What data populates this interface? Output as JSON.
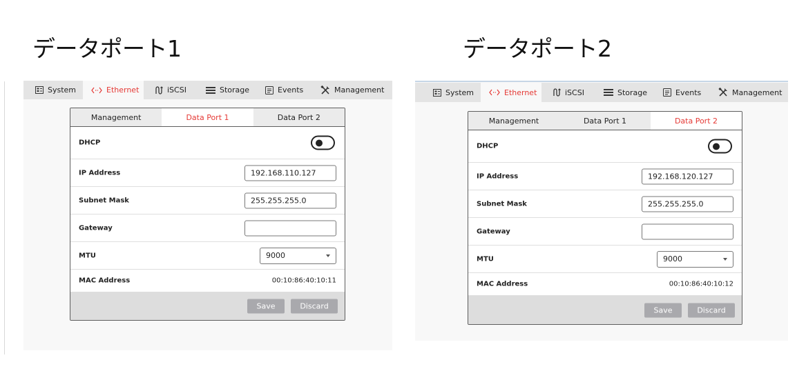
{
  "headings": [
    "データポート1",
    "データポート2"
  ],
  "nav": {
    "items": [
      {
        "label": "System",
        "icon": "system-icon"
      },
      {
        "label": "Ethernet",
        "icon": "ethernet-icon"
      },
      {
        "label": "iSCSI",
        "icon": "iscsi-icon"
      },
      {
        "label": "Storage",
        "icon": "storage-icon"
      },
      {
        "label": "Events",
        "icon": "events-icon"
      },
      {
        "label": "Management",
        "icon": "tools-icon"
      }
    ],
    "active_index": 1
  },
  "tabs": [
    "Management",
    "Data Port 1",
    "Data Port 2"
  ],
  "fields": {
    "dhcp_label": "DHCP",
    "ip_label": "IP Address",
    "subnet_label": "Subnet Mask",
    "gateway_label": "Gateway",
    "mtu_label": "MTU",
    "mac_label": "MAC Address"
  },
  "buttons": {
    "save": "Save",
    "discard": "Discard"
  },
  "ports": [
    {
      "active_tab": 1,
      "dhcp_enabled": false,
      "ip_address": "192.168.110.127",
      "subnet_mask": "255.255.255.0",
      "gateway": "",
      "mtu": "9000",
      "mac_address": "00:10:86:40:10:11"
    },
    {
      "active_tab": 2,
      "dhcp_enabled": false,
      "ip_address": "192.168.120.127",
      "subnet_mask": "255.255.255.0",
      "gateway": "",
      "mtu": "9000",
      "mac_address": "00:10:86:40:10:12"
    }
  ],
  "colors": {
    "accent": "#e53935",
    "nav_bar": "#e4e4e4",
    "button": "#a9a9ad"
  }
}
